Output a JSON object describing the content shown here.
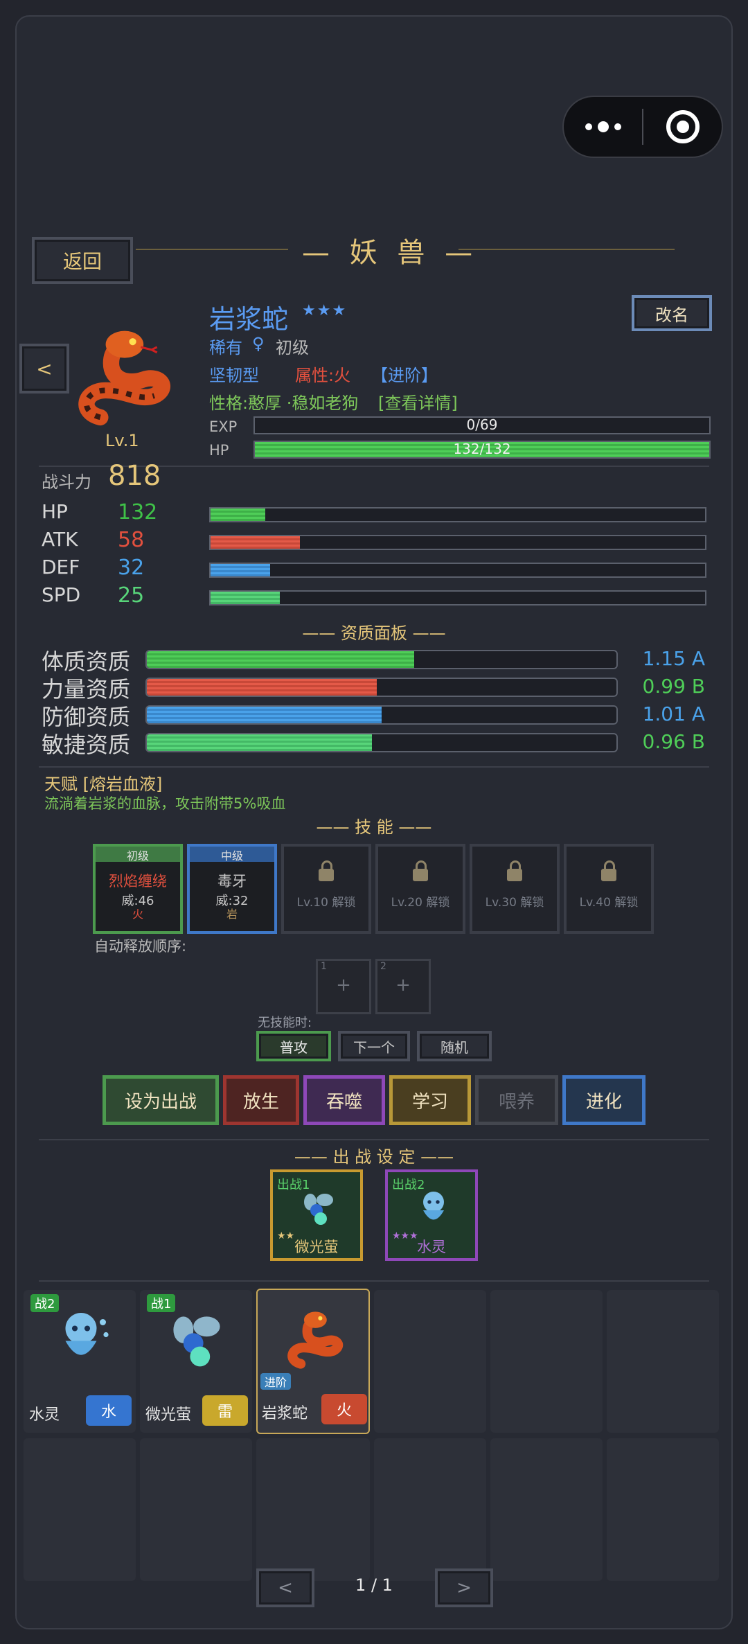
{
  "header": {
    "back": "返回",
    "title": "— 妖 兽 —"
  },
  "pet": {
    "name": "岩浆蛇",
    "stars": "★★★",
    "rarity": "稀有",
    "gender": "♀",
    "grade": "初级",
    "type": "坚韧型",
    "attribute": "属性:火",
    "advance": "【进阶】",
    "personality": "性格:憨厚 ·稳如老狗",
    "detail": "[查看详情]",
    "level": "Lv.1",
    "rename": "改名",
    "prev": "<",
    "exp_label": "EXP",
    "exp_text": "0/69",
    "exp_ratio": 0,
    "hp_label": "HP",
    "hp_text": "132/132",
    "hp_ratio": 1
  },
  "power": {
    "label": "战斗力",
    "value": "818"
  },
  "stats": [
    {
      "name": "HP",
      "value": "132",
      "color": "#3fc148",
      "ratio": 0.11
    },
    {
      "name": "ATK",
      "value": "58",
      "color": "#e2503e",
      "ratio": 0.18
    },
    {
      "name": "DEF",
      "value": "32",
      "color": "#4aa2ea",
      "ratio": 0.12
    },
    {
      "name": "SPD",
      "value": "25",
      "color": "#58d57a",
      "ratio": 0.14
    }
  ],
  "aptitude": {
    "title": "—— 资质面板 ——",
    "items": [
      {
        "name": "体质资质",
        "value": "1.15 A",
        "color": "#4aa2ea",
        "ratio": 0.57
      },
      {
        "name": "力量资质",
        "value": "0.99 B",
        "color": "#4fce58",
        "ratio": 0.49
      },
      {
        "name": "防御资质",
        "value": "1.01 A",
        "color": "#4aa2ea",
        "ratio": 0.5
      },
      {
        "name": "敏捷资质",
        "value": "0.96 B",
        "color": "#4fce58",
        "ratio": 0.48
      }
    ]
  },
  "talent": {
    "title": "天赋 [熔岩血液]",
    "desc": "流淌着岩浆的血脉，攻击附带5%吸血"
  },
  "skills": {
    "title": "—— 技 能 ——",
    "learned": [
      {
        "tier": "初级",
        "name": "烈焰缠绕",
        "power": "威:46",
        "elem": "火"
      },
      {
        "tier": "中级",
        "name": "毒牙",
        "power": "威:32",
        "elem": "岩"
      }
    ],
    "locked": [
      "Lv.10 解锁",
      "Lv.20 解锁",
      "Lv.30 解锁",
      "Lv.40 解锁"
    ],
    "auto_label": "自动释放顺序:",
    "order": [
      {
        "num": "1",
        "plus": "+"
      },
      {
        "num": "2",
        "plus": "+"
      }
    ],
    "noskill_label": "无技能时:",
    "noskill_opts": [
      "普攻",
      "下一个",
      "随机"
    ]
  },
  "actions": [
    "设为出战",
    "放生",
    "吞噬",
    "学习",
    "喂养",
    "进化"
  ],
  "battle": {
    "title": "—— 出 战 设 定 ——",
    "slots": [
      {
        "tag": "出战1",
        "stars": "★★",
        "name": "微光萤"
      },
      {
        "tag": "出战2",
        "stars": "★★★",
        "name": "水灵"
      }
    ]
  },
  "roster": [
    {
      "badge": "战2",
      "name": "水灵",
      "elem": "水"
    },
    {
      "badge": "战1",
      "name": "微光萤",
      "elem": "雷"
    },
    {
      "badge": "进阶",
      "name": "岩浆蛇",
      "elem": "火"
    }
  ],
  "pager": {
    "prev": "<",
    "text": "1 / 1",
    "next": ">"
  },
  "colors": {
    "gold": "#e5c67a",
    "blue": "#5a9bf2",
    "fire": "#e2503e",
    "water": "#3575d0",
    "thunder": "#c9a82c"
  }
}
